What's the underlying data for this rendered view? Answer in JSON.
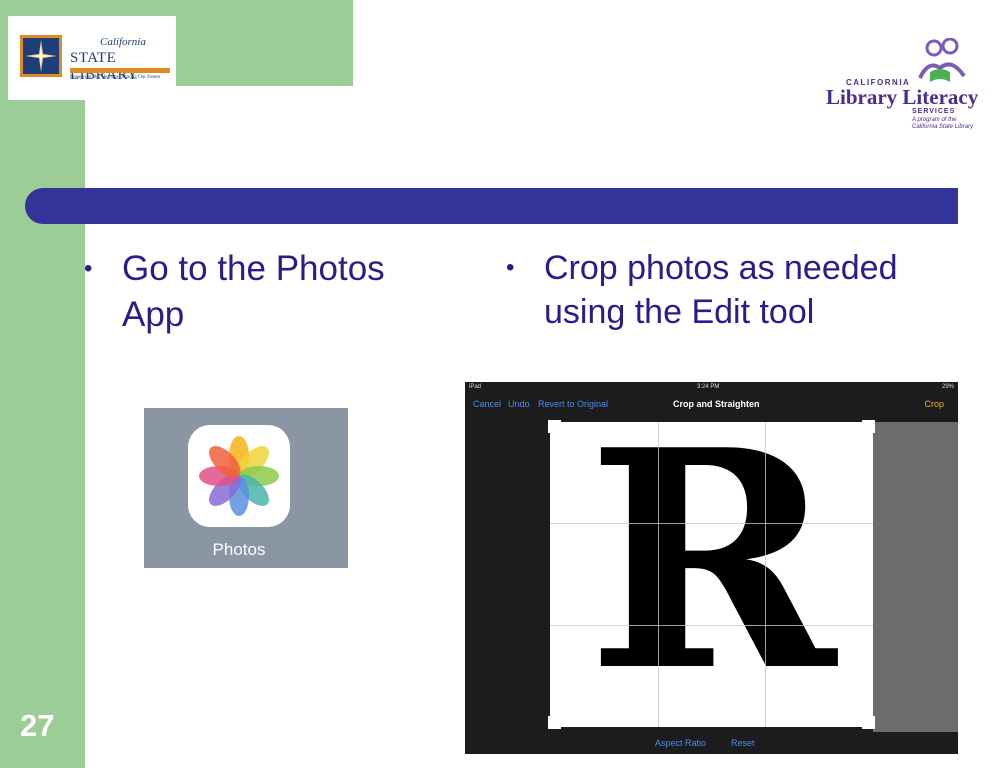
{
  "logos": {
    "left": {
      "line1": "California",
      "line2": "STATE LIBRARY",
      "tagline": "Preserving Our Heritage, Sharing Our Future"
    },
    "right": {
      "small": "CALIFORNIA",
      "big": "Library Literacy",
      "services": "SERVICES",
      "note1": "A program of the",
      "note2": "California State Library"
    }
  },
  "bullets": {
    "left": "Go to the Photos App",
    "right": "Crop photos as needed using the Edit tool"
  },
  "photos_app": {
    "label": "Photos"
  },
  "ipad": {
    "status_left": "iPad",
    "status_time": "3:24 PM",
    "status_battery": "29%",
    "toolbar": {
      "cancel": "Cancel",
      "undo": "Undo",
      "revert": "Revert to Original",
      "title": "Crop and Straighten",
      "crop": "Crop"
    },
    "image_letter": "R",
    "bottom": {
      "aspect": "Aspect Ratio",
      "reset": "Reset"
    }
  },
  "slide_number": "27",
  "colors": {
    "green": "#9dcd96",
    "blue_bar": "#333399",
    "text_purple": "#2e1a8c"
  }
}
